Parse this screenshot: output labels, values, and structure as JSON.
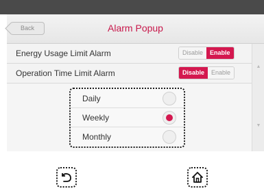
{
  "header": {
    "back_label": "Back",
    "title": "Alarm Popup"
  },
  "settings": [
    {
      "label": "Energy Usage Limit Alarm",
      "options": [
        "Disable",
        "Enable"
      ],
      "selected": "Enable"
    },
    {
      "label": "Operation Time Limit Alarm",
      "options": [
        "Disable",
        "Enable"
      ],
      "selected": "Disable"
    }
  ],
  "period_options": [
    {
      "label": "Daily",
      "selected": false
    },
    {
      "label": "Weekly",
      "selected": true
    },
    {
      "label": "Monthly",
      "selected": false
    }
  ],
  "bottom_nav": {
    "back_icon": "return-arrow-icon",
    "home_icon": "home-icon"
  },
  "colors": {
    "accent": "#d4184f",
    "title": "#c8184b",
    "status_bar": "#4a4a4a"
  }
}
